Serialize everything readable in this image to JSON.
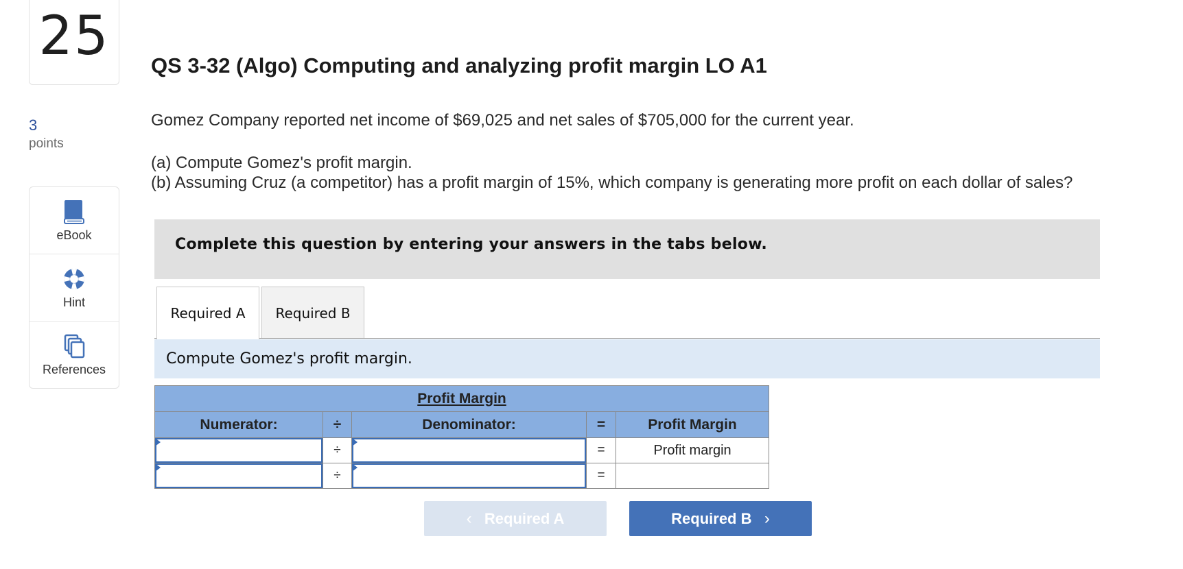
{
  "question": {
    "number": "25",
    "points_value": "3",
    "points_label": "points",
    "title": "QS 3-32 (Algo) Computing and analyzing profit margin LO A1",
    "statement": "Gomez Company reported net income of $69,025 and net sales of $705,000 for the current year.",
    "part_a": "(a) Compute Gomez's profit margin.",
    "part_b": "(b) Assuming Cruz (a competitor) has a profit margin of 15%, which company is generating more profit on each dollar of sales?"
  },
  "tools": [
    {
      "label": "eBook",
      "icon": "book-icon"
    },
    {
      "label": "Hint",
      "icon": "lifebuoy-icon"
    },
    {
      "label": "References",
      "icon": "copy-icon"
    }
  ],
  "instructions": "Complete this question by entering your answers in the tabs below.",
  "tabs": [
    {
      "label": "Required A",
      "active": true
    },
    {
      "label": "Required B",
      "active": false
    }
  ],
  "subtask": "Compute Gomez's profit margin.",
  "table": {
    "title": "Profit Margin",
    "headers": {
      "numerator": "Numerator:",
      "divide": "÷",
      "denominator": "Denominator:",
      "equals": "=",
      "result": "Profit Margin"
    },
    "rows": [
      {
        "numerator": "",
        "divide": "÷",
        "denominator": "",
        "equals": "=",
        "result": "Profit margin"
      },
      {
        "numerator": "",
        "divide": "÷",
        "denominator": "",
        "equals": "=",
        "result": ""
      }
    ]
  },
  "nav": {
    "prev_label": "Required A",
    "next_label": "Required B",
    "prev_chevron": "‹",
    "next_chevron": "›"
  },
  "colors": {
    "accent": "#4472b8",
    "table_header": "#88aee0",
    "subtask_bg": "#dde9f6",
    "disabled_button": "#dbe4f0"
  }
}
